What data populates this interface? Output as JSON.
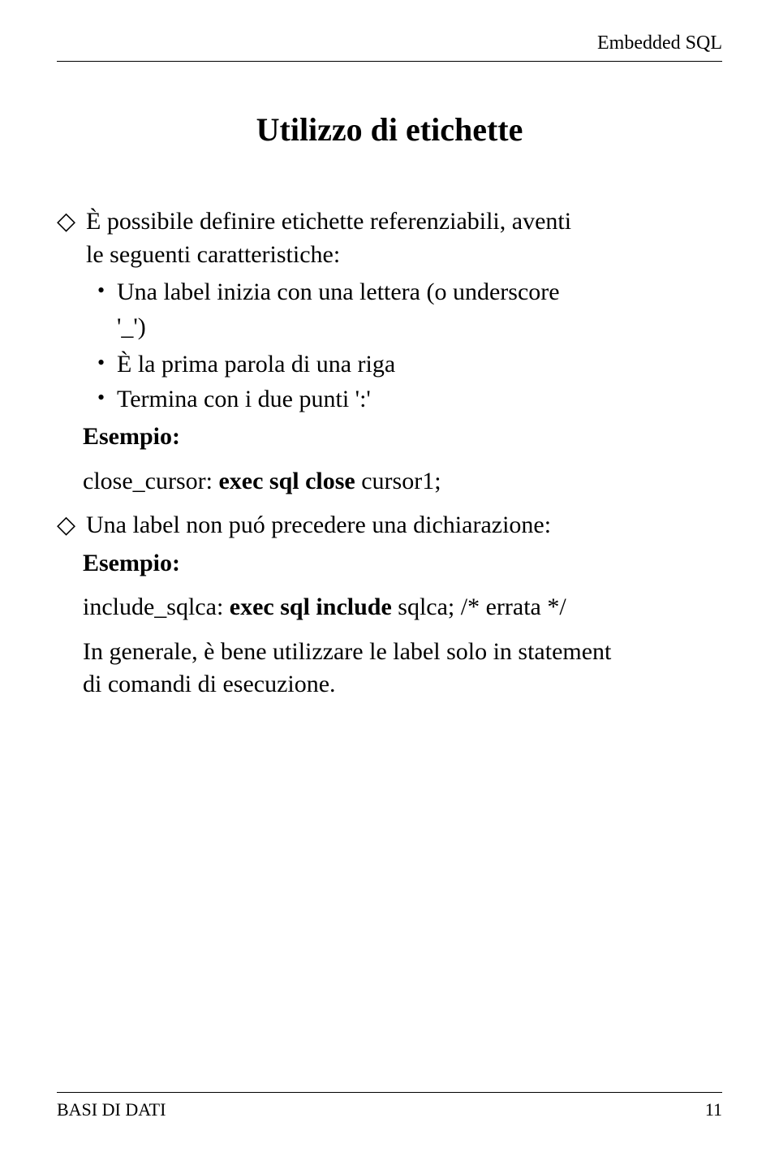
{
  "header": {
    "running_title": "Embedded SQL"
  },
  "title": "Utilizzo di etichette",
  "block1": {
    "intro_a": "È possibile definire etichette referenziabili, aventi",
    "intro_b": "le seguenti caratteristiche:",
    "bullets": {
      "b1a": "Una label inizia con una lettera (o underscore",
      "b1b": "'_')",
      "b2": "È la prima parola di una riga",
      "b3": "Termina con i due punti ':'"
    },
    "example_label": "Esempio:",
    "example_code_a": "close_cursor: ",
    "example_code_b": "exec sql close",
    "example_code_c": " cursor1;"
  },
  "block2": {
    "intro": "Una label non puó precedere una dichiarazione:",
    "example_label": "Esempio:",
    "example_code_a": "include_sqlca: ",
    "example_code_b": "exec sql include",
    "example_code_c": " sqlca; /* errata */",
    "closing_a": "In generale, è bene utilizzare le label solo in statement",
    "closing_b": "di comandi di esecuzione."
  },
  "footer": {
    "left": "BASI DI DATI",
    "right": "11"
  }
}
